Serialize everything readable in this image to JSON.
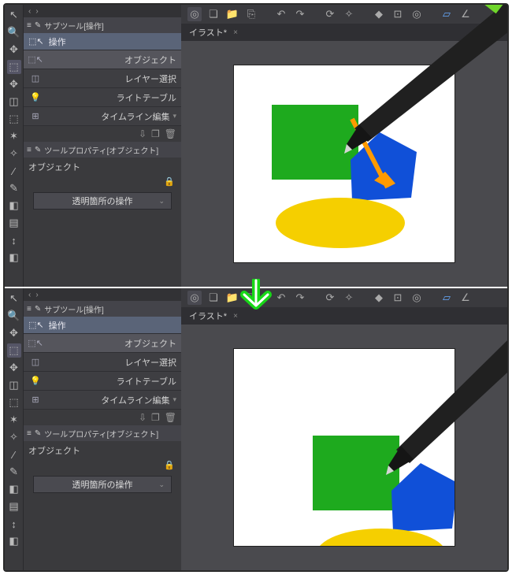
{
  "subtool_header": "サブツール[操作]",
  "subtool_group": "操作",
  "subtool": {
    "object": "オブジェクト",
    "layer_select": "レイヤー選択",
    "light_table": "ライトテーブル",
    "timeline_edit": "タイムライン編集"
  },
  "toolprop_header": "ツールプロパティ[オブジェクト]",
  "prop_label": "オブジェクト",
  "dropdown": "透明箇所の操作",
  "canvas_tab": "イラスト*",
  "top_toolbar_icons": [
    "swirl",
    "new",
    "open",
    "save",
    "sep",
    "undo",
    "redo",
    "sep",
    "sync",
    "scale",
    "sep",
    "diamond",
    "crop",
    "swirl2",
    "sep",
    "bluesel",
    "angle"
  ],
  "sidebar_tools": [
    "arrow",
    "magnify",
    "move",
    "selbox",
    "move4",
    "lasso-cube",
    "dotted",
    "star",
    "wand",
    "dropper",
    "pen",
    "grad",
    "bucket",
    "swap",
    "eraser"
  ]
}
